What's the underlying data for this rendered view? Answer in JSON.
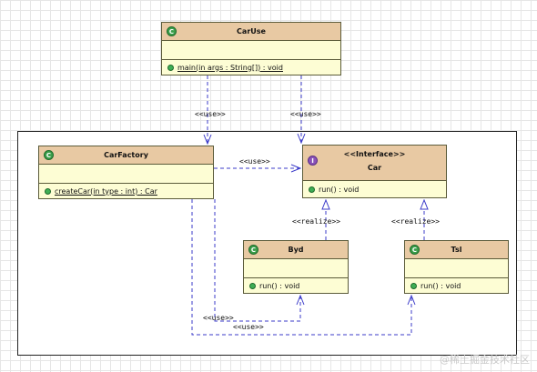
{
  "classes": {
    "caruse": {
      "name": "CarUse",
      "op": "main(in args : String[]) : void"
    },
    "carfactory": {
      "name": "CarFactory",
      "op": "createCar(in type : int) : Car"
    },
    "car": {
      "stereotype": "<<Interface>>",
      "name": "Car",
      "op": "run() : void"
    },
    "byd": {
      "name": "Byd",
      "op": "run() : void"
    },
    "tsl": {
      "name": "Tsl",
      "op": "run() : void"
    }
  },
  "labels": {
    "use": "<<use>>",
    "realize": "<<realize>>"
  },
  "badges": {
    "class": "C",
    "interface": "I"
  },
  "watermark": "@稀土掘金技术社区",
  "colors": {
    "header": "#e8c9a3",
    "body": "#fdfdd4",
    "edge": "#3b3bc9",
    "class_badge": "#3a9e4a",
    "interface_badge": "#8a52b8"
  }
}
